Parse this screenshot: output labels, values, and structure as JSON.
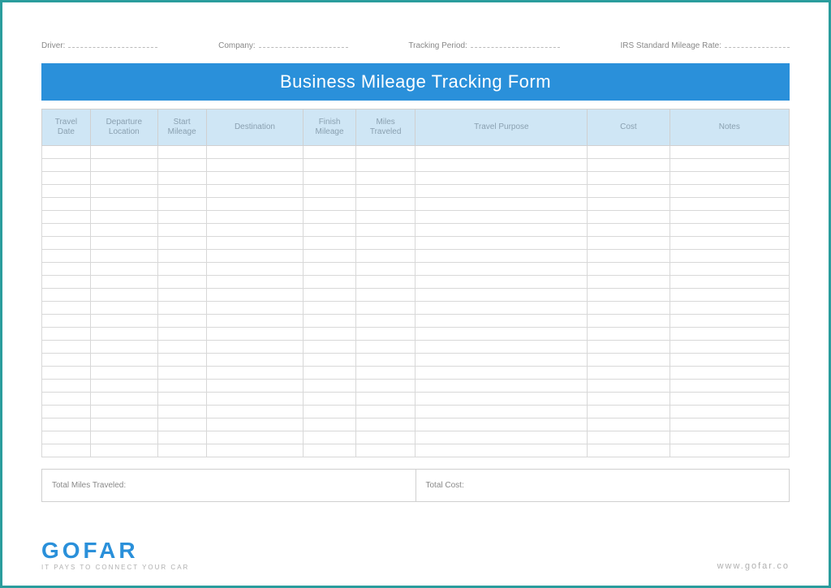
{
  "header_fields": {
    "driver": "Driver:",
    "company": "Company:",
    "tracking_period": "Tracking Period:",
    "irs_rate": "IRS Standard Mileage Rate:"
  },
  "title": "Business Mileage Tracking Form",
  "columns": {
    "travel_date": "Travel\nDate",
    "departure": "Departure\nLocation",
    "start_mileage": "Start\nMileage",
    "destination": "Destination",
    "finish_mileage": "Finish\nMileage",
    "miles_traveled": "Miles\nTraveled",
    "travel_purpose": "Travel Purpose",
    "cost": "Cost",
    "notes": "Notes"
  },
  "row_count": 24,
  "totals": {
    "miles": "Total Miles Traveled:",
    "cost": "Total Cost:"
  },
  "logo": {
    "text": "GOFAR",
    "tagline": "IT PAYS TO CONNECT YOUR CAR"
  },
  "website": "www.gofar.co"
}
